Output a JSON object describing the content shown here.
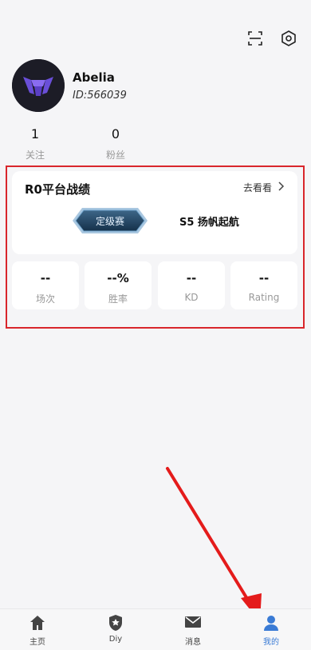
{
  "header": {
    "icons": [
      {
        "name": "scan-icon"
      },
      {
        "name": "settings-icon"
      }
    ]
  },
  "profile": {
    "username": "Abelia",
    "user_id": "ID:566039"
  },
  "stats": [
    {
      "value": "1",
      "label": "关注"
    },
    {
      "value": "0",
      "label": "粉丝"
    }
  ],
  "record_card": {
    "title": "R0平台战绩",
    "link_label": "去看看",
    "rank_badge": "定级赛",
    "season": "S5  扬帆起航"
  },
  "metrics": [
    {
      "value": "--",
      "label": "场次"
    },
    {
      "value": "--%",
      "label": "胜率"
    },
    {
      "value": "--",
      "label": "KD"
    },
    {
      "value": "--",
      "label": "Rating"
    }
  ],
  "tabbar": {
    "tabs": [
      {
        "label": "主页",
        "icon": "home-icon"
      },
      {
        "label": "Diy",
        "icon": "shield-star-icon"
      },
      {
        "label": "消息",
        "icon": "mail-icon"
      },
      {
        "label": "我的",
        "icon": "user-icon",
        "active": true
      }
    ]
  },
  "colors": {
    "accent": "#3a7bd5",
    "highlight": "#d9262c"
  }
}
